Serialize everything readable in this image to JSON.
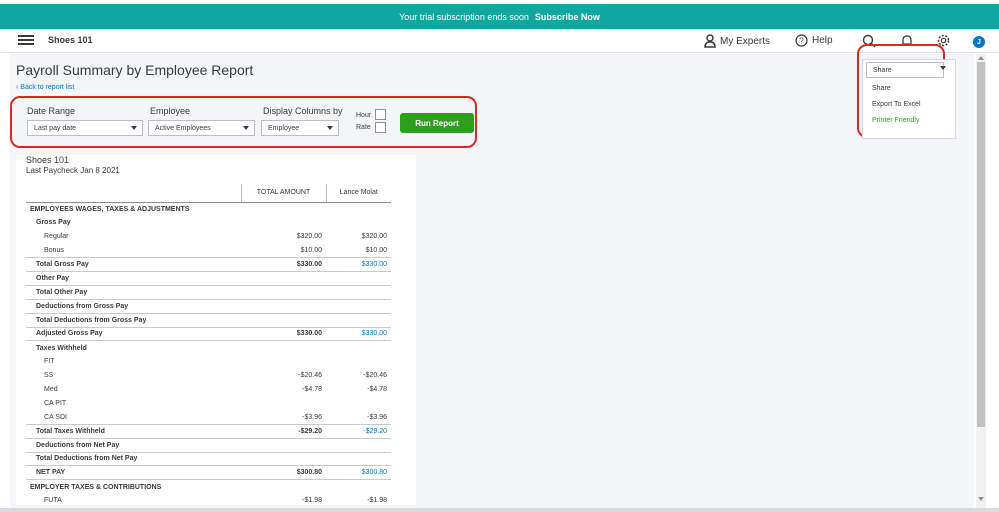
{
  "banner": {
    "message": "Your trial subscription ends soon",
    "cta": "Subscribe Now"
  },
  "topbar": {
    "company": "Shoes 101",
    "my_experts": "My Experts",
    "help": "Help",
    "avatar_initial": "J"
  },
  "page": {
    "title": "Payroll Summary by Employee Report",
    "back_link": "Back to report list"
  },
  "filters": {
    "date_range_label": "Date Range",
    "date_range_value": "Last pay date",
    "employee_label": "Employee",
    "employee_value": "Active Employees",
    "display_columns_label": "Display Columns by",
    "display_columns_value": "Employee",
    "hour_label": "Hour",
    "rate_label": "Rate",
    "run_button": "Run Report"
  },
  "share_menu": {
    "button_label": "Share",
    "items": [
      "Share",
      "Export To Excel",
      "Printer Friendly"
    ]
  },
  "report": {
    "company": "Shoes 101",
    "subtitle": "Last Paycheck Jan 8 2021",
    "columns": [
      "TOTAL AMOUNT",
      "Lance Molat"
    ],
    "rows": [
      {
        "label": "EMPLOYEES WAGES, TAXES & ADJUSTMENTS",
        "total": "",
        "emp": ""
      },
      {
        "label": "Gross Pay",
        "total": "",
        "emp": ""
      },
      {
        "label": "Regular",
        "total": "$320.00",
        "emp": "$320.00"
      },
      {
        "label": "Bonus",
        "total": "$10.00",
        "emp": "$10.00"
      },
      {
        "label": "Total Gross Pay",
        "total": "$330.00",
        "emp": "$330.00"
      },
      {
        "label": "Other Pay",
        "total": "",
        "emp": ""
      },
      {
        "label": "Total Other Pay",
        "total": "",
        "emp": ""
      },
      {
        "label": "Deductions from Gross Pay",
        "total": "",
        "emp": ""
      },
      {
        "label": "Total Deductions from Gross Pay",
        "total": "",
        "emp": ""
      },
      {
        "label": "Adjusted Gross Pay",
        "total": "$330.00",
        "emp": "$330.00"
      },
      {
        "label": "Taxes Withheld",
        "total": "",
        "emp": ""
      },
      {
        "label": "FIT",
        "total": "",
        "emp": ""
      },
      {
        "label": "SS",
        "total": "-$20.46",
        "emp": "-$20.46"
      },
      {
        "label": "Med",
        "total": "-$4.78",
        "emp": "-$4.78"
      },
      {
        "label": "CA PIT",
        "total": "",
        "emp": ""
      },
      {
        "label": "CA SDI",
        "total": "-$3.96",
        "emp": "-$3.96"
      },
      {
        "label": "Total Taxes Withheld",
        "total": "-$29.20",
        "emp": "-$29.20"
      },
      {
        "label": "Deductions from Net Pay",
        "total": "",
        "emp": ""
      },
      {
        "label": "Total Deductions from Net Pay",
        "total": "",
        "emp": ""
      },
      {
        "label": "NET PAY",
        "total": "$300.80",
        "emp": "$300.80"
      },
      {
        "label": "EMPLOYER TAXES & CONTRIBUTIONS",
        "total": "",
        "emp": ""
      },
      {
        "label": "FUTA",
        "total": "-$1.98",
        "emp": "-$1.98"
      }
    ]
  }
}
